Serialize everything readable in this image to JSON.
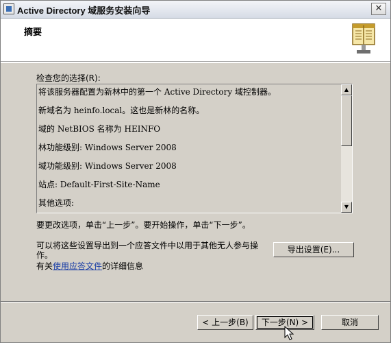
{
  "window": {
    "title": "Active Directory 域服务安装向导",
    "close_glyph": "✕"
  },
  "header": {
    "title": "摘要"
  },
  "review": {
    "label": "检查您的选择(R):",
    "lines": [
      "将该服务器配置为新林中的第一个 Active Directory 域控制器。",
      "新域名为 heinfo.local。这也是新林的名称。",
      "域的 NetBIOS 名称为 HEINFO",
      "林功能级别: Windows Server 2008",
      "域功能级别: Windows Server 2008",
      "站点: Default-First-Site-Name",
      "其他选项:"
    ]
  },
  "hint": "要更改选项，单击“上一步”。要开始操作，单击“下一步”。",
  "export": {
    "text": "可以将这些设置导出到一个应答文件中以用于其他无人参与操作。",
    "button_label": "导出设置(E)..."
  },
  "help": {
    "prefix": "有关",
    "link": "使用应答文件",
    "suffix": "的详细信息"
  },
  "buttons": {
    "back": "< 上一步(B)",
    "next": "下一步(N) >",
    "cancel": "取消"
  },
  "scrollbar": {
    "up_glyph": "▲",
    "down_glyph": "▼"
  },
  "icons": {
    "window": "window-icon",
    "header": "book-icon",
    "cursor": "mouse-pointer-icon"
  },
  "colors": {
    "dialog_bg": "#d4d0c8",
    "link": "#1a3ea6"
  }
}
